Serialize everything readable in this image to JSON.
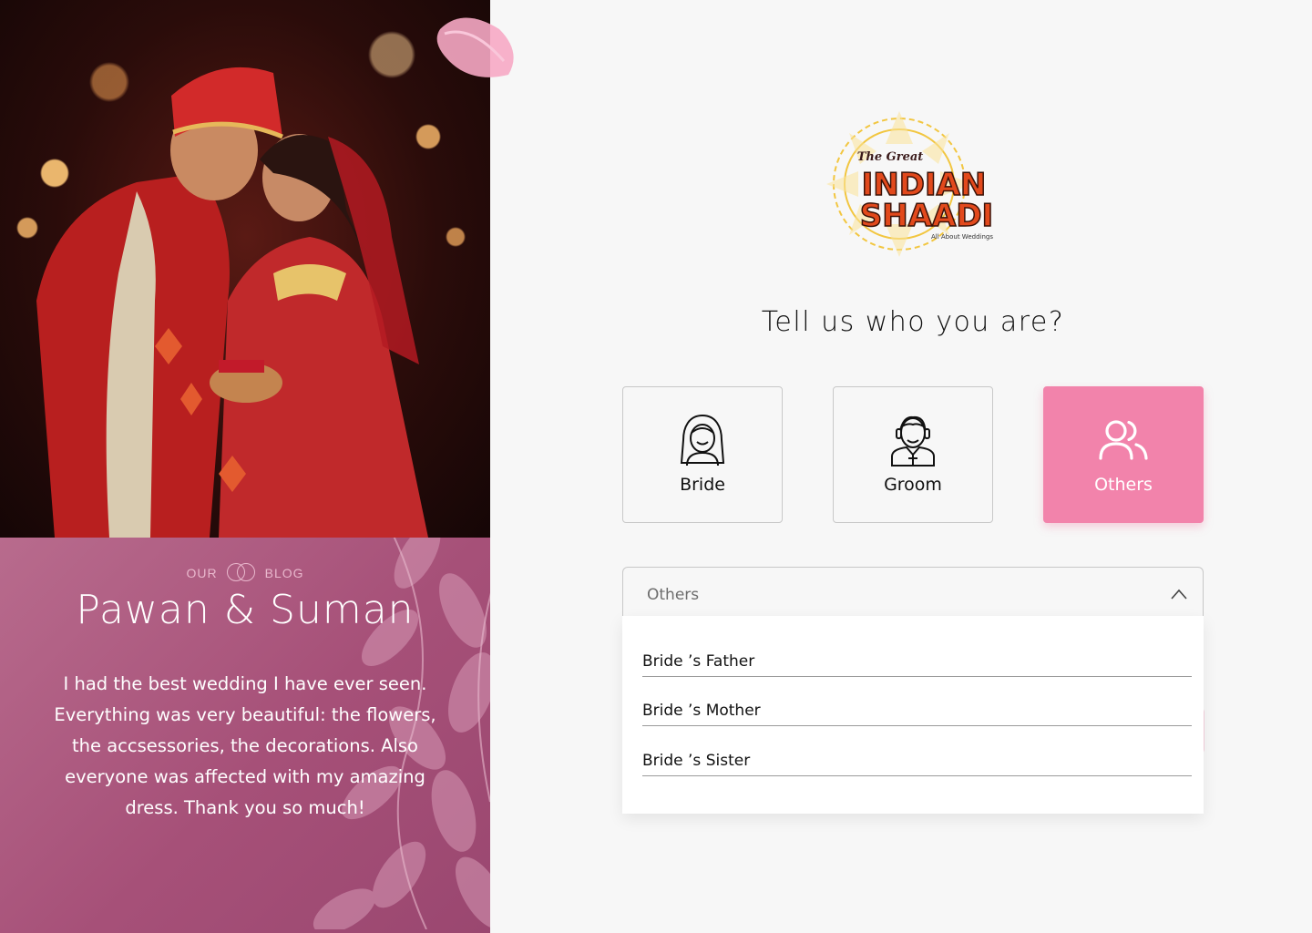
{
  "blog": {
    "tag_left": "OUR",
    "tag_right": "BLOG",
    "couple": "Pawan & Suman",
    "quote": "I had the best wedding I have ever seen. Everything was very beautiful: the flowers, the accsessories, the decorations. Also everyone was affected with my amazing dress. Thank you so much!"
  },
  "logo": {
    "line1": "The Great",
    "line2": "INDIAN",
    "line3": "SHAADI",
    "tagline": "All About Weddings"
  },
  "heading": "Tell us who you are?",
  "roles": [
    {
      "label": "Bride",
      "icon": "bride-icon"
    },
    {
      "label": "Groom",
      "icon": "groom-icon"
    },
    {
      "label": "Others",
      "icon": "users-icon",
      "selected": true
    }
  ],
  "select": {
    "value": "Others",
    "icon": "chevron-up-icon",
    "options": [
      "Bride ’s Father",
      "Bride ’s Mother",
      "Bride ’s Sister"
    ]
  },
  "colors": {
    "accent": "#f283ab",
    "blog_bg": "#a65078",
    "background": "#f7f7f7"
  }
}
